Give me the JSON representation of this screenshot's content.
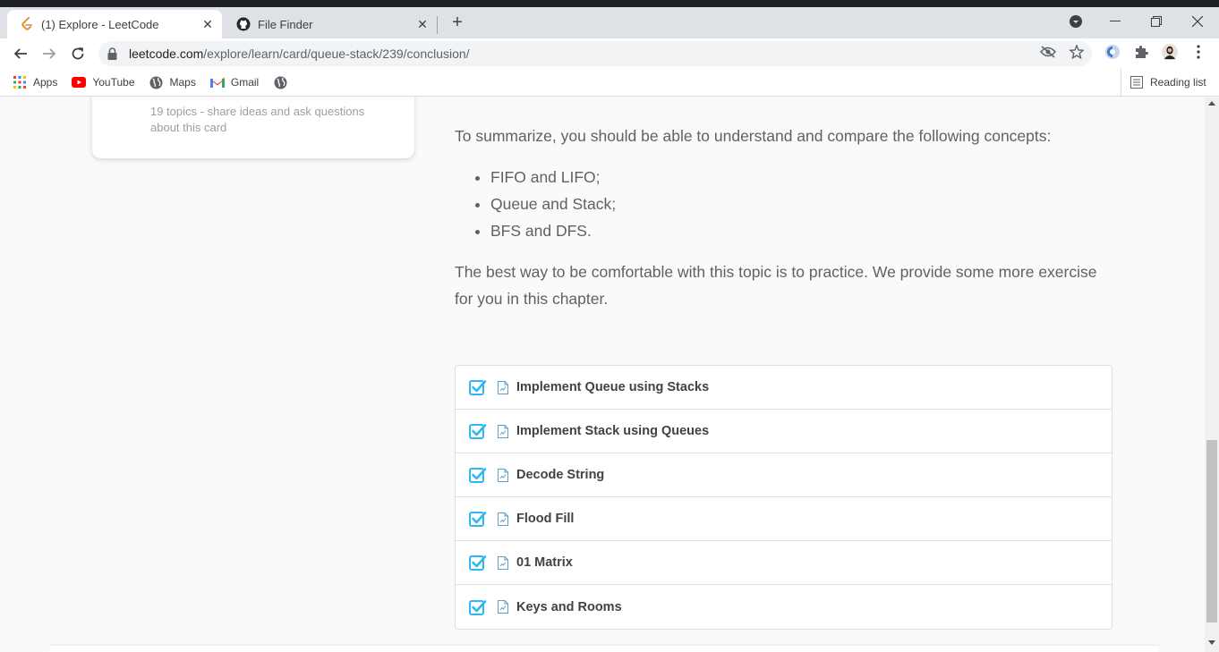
{
  "browser": {
    "tabs": [
      {
        "title": "(1) Explore - LeetCode",
        "active": true,
        "icon": "leetcode-icon"
      },
      {
        "title": "File Finder",
        "active": false,
        "icon": "github-icon"
      }
    ],
    "url_host": "leetcode.com",
    "url_path": "/explore/learn/card/queue-stack/239/conclusion/",
    "bookmarks": [
      {
        "label": "Apps",
        "icon": "apps-grid-icon"
      },
      {
        "label": "YouTube",
        "icon": "youtube-icon"
      },
      {
        "label": "Maps",
        "icon": "globe-icon"
      },
      {
        "label": "Gmail",
        "icon": "gmail-icon"
      },
      {
        "label": "",
        "icon": "globe-icon"
      }
    ],
    "reading_list": "Reading list"
  },
  "sidebar_card": {
    "description": "19 topics - share ideas and ask questions about this card"
  },
  "content": {
    "intro": "To summarize, you should be able to understand and compare the following concepts:",
    "concepts": [
      "FIFO and LIFO;",
      "Queue and Stack;",
      "BFS and DFS."
    ],
    "outro": "The best way to be comfortable with this topic is to practice. We provide some more exercise for you in this chapter."
  },
  "problems": [
    {
      "title": "Implement Queue using Stacks",
      "completed": true
    },
    {
      "title": "Implement Stack using Queues",
      "completed": true
    },
    {
      "title": "Decode String",
      "completed": true
    },
    {
      "title": "Flood Fill",
      "completed": true
    },
    {
      "title": "01 Matrix",
      "completed": true
    },
    {
      "title": "Keys and Rooms",
      "completed": true
    }
  ],
  "colors": {
    "check": "#2db7f5",
    "doc": "#5e9ec8"
  }
}
